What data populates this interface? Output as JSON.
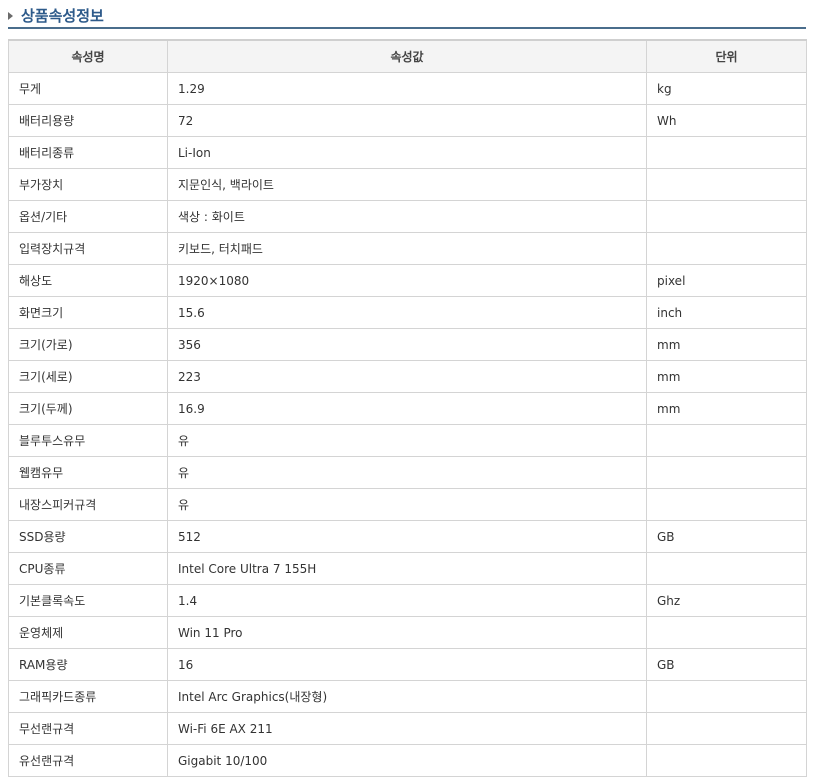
{
  "section": {
    "title": "상품속성정보"
  },
  "table": {
    "headers": [
      "속성명",
      "속성값",
      "단위"
    ],
    "rows": [
      [
        "무게",
        "1.29",
        "kg"
      ],
      [
        "배터리용량",
        "72",
        "Wh"
      ],
      [
        "배터리종류",
        "Li-Ion",
        ""
      ],
      [
        "부가장치",
        "지문인식, 백라이트",
        ""
      ],
      [
        "옵션/기타",
        "색상 : 화이트",
        ""
      ],
      [
        "입력장치규격",
        "키보드, 터치패드",
        ""
      ],
      [
        "해상도",
        "1920×1080",
        "pixel"
      ],
      [
        "화면크기",
        "15.6",
        "inch"
      ],
      [
        "크기(가로)",
        "356",
        "mm"
      ],
      [
        "크기(세로)",
        "223",
        "mm"
      ],
      [
        "크기(두께)",
        "16.9",
        "mm"
      ],
      [
        "블루투스유무",
        "유",
        ""
      ],
      [
        "웹캠유무",
        "유",
        ""
      ],
      [
        "내장스피커규격",
        "유",
        ""
      ],
      [
        "SSD용량",
        "512",
        "GB"
      ],
      [
        "CPU종류",
        "Intel Core Ultra 7 155H",
        ""
      ],
      [
        "기본클록속도",
        "1.4",
        "Ghz"
      ],
      [
        "운영체제",
        "Win 11 Pro",
        ""
      ],
      [
        "RAM용량",
        "16",
        "GB"
      ],
      [
        "그래픽카드종류",
        "Intel Arc Graphics(내장형)",
        ""
      ],
      [
        "무선랜규격",
        "Wi-Fi 6E AX 211",
        ""
      ],
      [
        "유선랜규격",
        "Gigabit 10/100",
        ""
      ]
    ]
  }
}
